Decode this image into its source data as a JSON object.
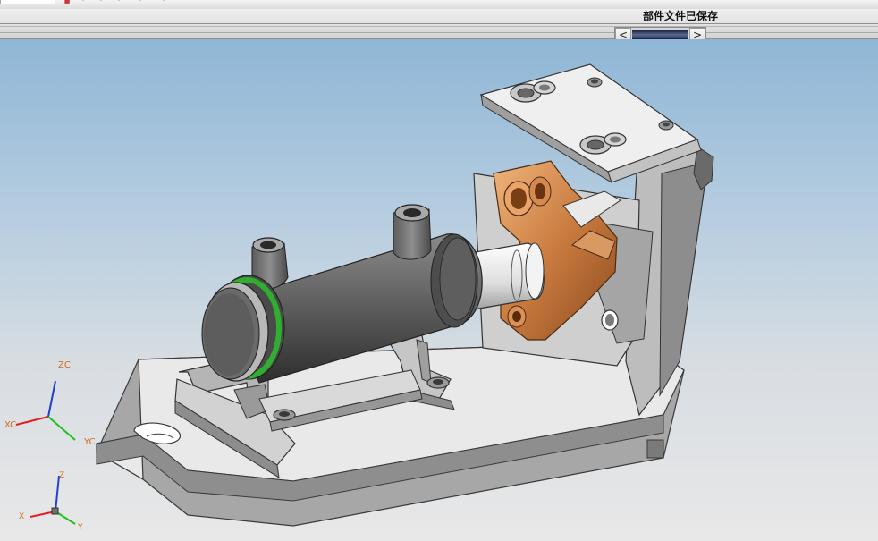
{
  "status": {
    "message": "部件文件已保存"
  },
  "toolbar": {
    "scroll_left_label": "<",
    "scroll_right_label": ">"
  },
  "triad_main": {
    "x_label": "XC",
    "y_label": "YC",
    "z_label": "ZC"
  },
  "triad_absolute": {
    "x_label": "X",
    "y_label": "Y",
    "z_label": "Z"
  },
  "colors": {
    "viewport_top": "#8fb6d6",
    "viewport_bottom": "#e8e8e8",
    "axis_x": "#e02020",
    "axis_y": "#20c020",
    "axis_z": "#2040d0",
    "cylinder_body": "#5a5a5a",
    "seal_ring": "#2fae2f",
    "bracket_copper": "#c97b3f",
    "fixture_gray": "#d9d9d9"
  },
  "icons": [
    "scroll-left-arrow-icon",
    "scroll-right-arrow-icon",
    "wcs-triad-icon",
    "absolute-triad-icon"
  ]
}
